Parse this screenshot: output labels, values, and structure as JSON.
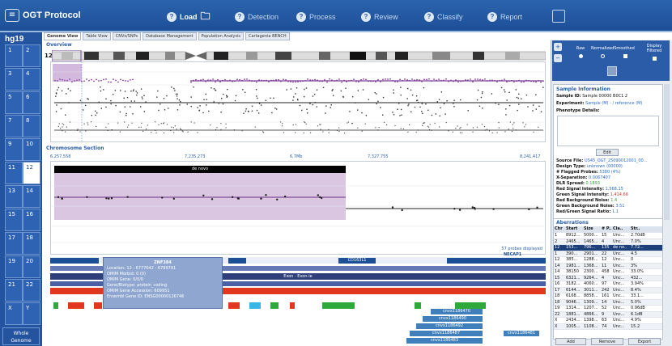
{
  "app": {
    "title": "OGT Protocol"
  },
  "steps": [
    {
      "label": "Load",
      "active": true
    },
    {
      "label": "Detection",
      "active": false
    },
    {
      "label": "Process",
      "active": false
    },
    {
      "label": "Review",
      "active": false
    },
    {
      "label": "Classify",
      "active": false
    },
    {
      "label": "Report",
      "active": false
    }
  ],
  "genome": {
    "label": "hg19",
    "whole_genome": "Whole Genome"
  },
  "chromosomes": [
    "1",
    "2",
    "3",
    "4",
    "5",
    "6",
    "7",
    "8",
    "9",
    "10",
    "11",
    "12",
    "13",
    "14",
    "15",
    "16",
    "17",
    "18",
    "19",
    "20",
    "21",
    "22",
    "X",
    "Y"
  ],
  "tabs": [
    "Genome View",
    "Table View",
    "CNVs/SNPs",
    "Database Management",
    "Population Analysis",
    "Cartagenia BENCH"
  ],
  "overview": {
    "label": "Overview",
    "chromosome": "12"
  },
  "chrom_section": {
    "label": "Chromosome Section",
    "ticks": [
      "6,257,558",
      "7,235,273",
      "6,7Mb",
      "7,327,755",
      "8,241,417"
    ],
    "region_label": "de novo",
    "probes_label": "57 probes displayed",
    "gene_label": "NECAP1",
    "exon_label": "Exon · Exon-ie",
    "gene2_label": "CD163L1"
  },
  "tooltip": {
    "title": "ZNF384",
    "lines": [
      "Location: 12 : 6777642 - 6799791",
      "OMIM Morbid: 0 (0)",
      "OMIM Gene: 0/0/0",
      "Gene/Biotype: protein_coding",
      "OMIM Gene Accession: 609951",
      "Ensembl Gene ID: ENSG00000126746"
    ]
  },
  "cnv_boxes": [
    "cnvx1186470",
    "cnvx1186490",
    "cnvx1186492",
    "cnvx1186487",
    "cnvx1186483",
    "cnvx1186481"
  ],
  "view": {
    "options": [
      "Raw",
      "Normalized",
      "Smoothed",
      "Display Filtered"
    ]
  },
  "sample_info": {
    "header": "Sample Information",
    "sample_id_label": "Sample ID:",
    "sample_id": "Sample 00000 B0C1 2",
    "experiment_label": "Experiment:",
    "experiment": "Sample (M) - / reference (M)",
    "phenotype_label": "Phenotype Details:",
    "edit_button": "Edit",
    "fields": [
      {
        "k": "Source File:",
        "v": "US45_OGT_25090012001_00...",
        "c": "blue"
      },
      {
        "k": "Design Type:",
        "v": "unknown (00000)",
        "c": "blue"
      },
      {
        "k": "# Flagged Probes:",
        "v": "5380 (4%)",
        "c": "blue"
      },
      {
        "k": "X-Separation:",
        "v": "0.0067407",
        "c": "blue"
      },
      {
        "k": "DLR Spread:",
        "v": "0.1893",
        "c": "green"
      },
      {
        "k": "Red Signal Intensity:",
        "v": "1,568.15",
        "c": "blue"
      },
      {
        "k": "Green Signal Intensity:",
        "v": "1,414.66",
        "c": "red"
      },
      {
        "k": "Red Background Noise:",
        "v": "1.4",
        "c": "green"
      },
      {
        "k": "Green Background Noise:",
        "v": "3.51",
        "c": "blue"
      },
      {
        "k": "Red/Green Signal Ratio:",
        "v": "1.1",
        "c": "blue"
      }
    ]
  },
  "aberrations": {
    "header": "Aberrations",
    "columns": [
      "Chr",
      "Start",
      "Size",
      "# P..",
      "Cla..",
      "Str.."
    ],
    "rows": [
      [
        "1",
        "8912...",
        "5000...",
        "15",
        "Unc...",
        "2.70dB"
      ],
      [
        "2",
        "2465...",
        "1465...",
        "4",
        "Unc...",
        "7.0%"
      ],
      [
        "12",
        "153...",
        "796...",
        "135",
        "de no..",
        "7.72..."
      ],
      [
        "1",
        "390...",
        "2901...",
        "22",
        "Unc...",
        "4.5"
      ],
      [
        "12",
        "385...",
        "1288...",
        "12",
        "Unc...",
        "0"
      ],
      [
        "14",
        "1981...",
        "1368...",
        "11",
        "Unc...",
        "3%"
      ],
      [
        "14",
        "38150",
        "2300...",
        "458",
        "Unc...",
        "33.0%"
      ],
      [
        "15",
        "6321...",
        "9264...",
        "4",
        "Unc...",
        "432..."
      ],
      [
        "16",
        "3182...",
        "4060...",
        "97",
        "Unc...",
        "3.94%"
      ],
      [
        "17",
        "6144...",
        "3011...",
        "242",
        "Unc...",
        "8.4%"
      ],
      [
        "18",
        "6168...",
        "8858...",
        "161",
        "Unc...",
        "33.1..."
      ],
      [
        "18",
        "9046...",
        "1309...",
        "14",
        "Unc...",
        "5.0%"
      ],
      [
        "19",
        "1314...",
        "1207...",
        "52",
        "Unc...",
        "0.96dB"
      ],
      [
        "22",
        "1881...",
        "4866...",
        "9",
        "Unc...",
        "6.1dB"
      ],
      [
        "X",
        "2434...",
        "1398...",
        "63",
        "Unc...",
        "4.9%"
      ],
      [
        "X",
        "1005...",
        "1108...",
        "74",
        "Unc...",
        "15.2"
      ]
    ],
    "buttons": [
      "Add",
      "Remove",
      "Export"
    ]
  }
}
